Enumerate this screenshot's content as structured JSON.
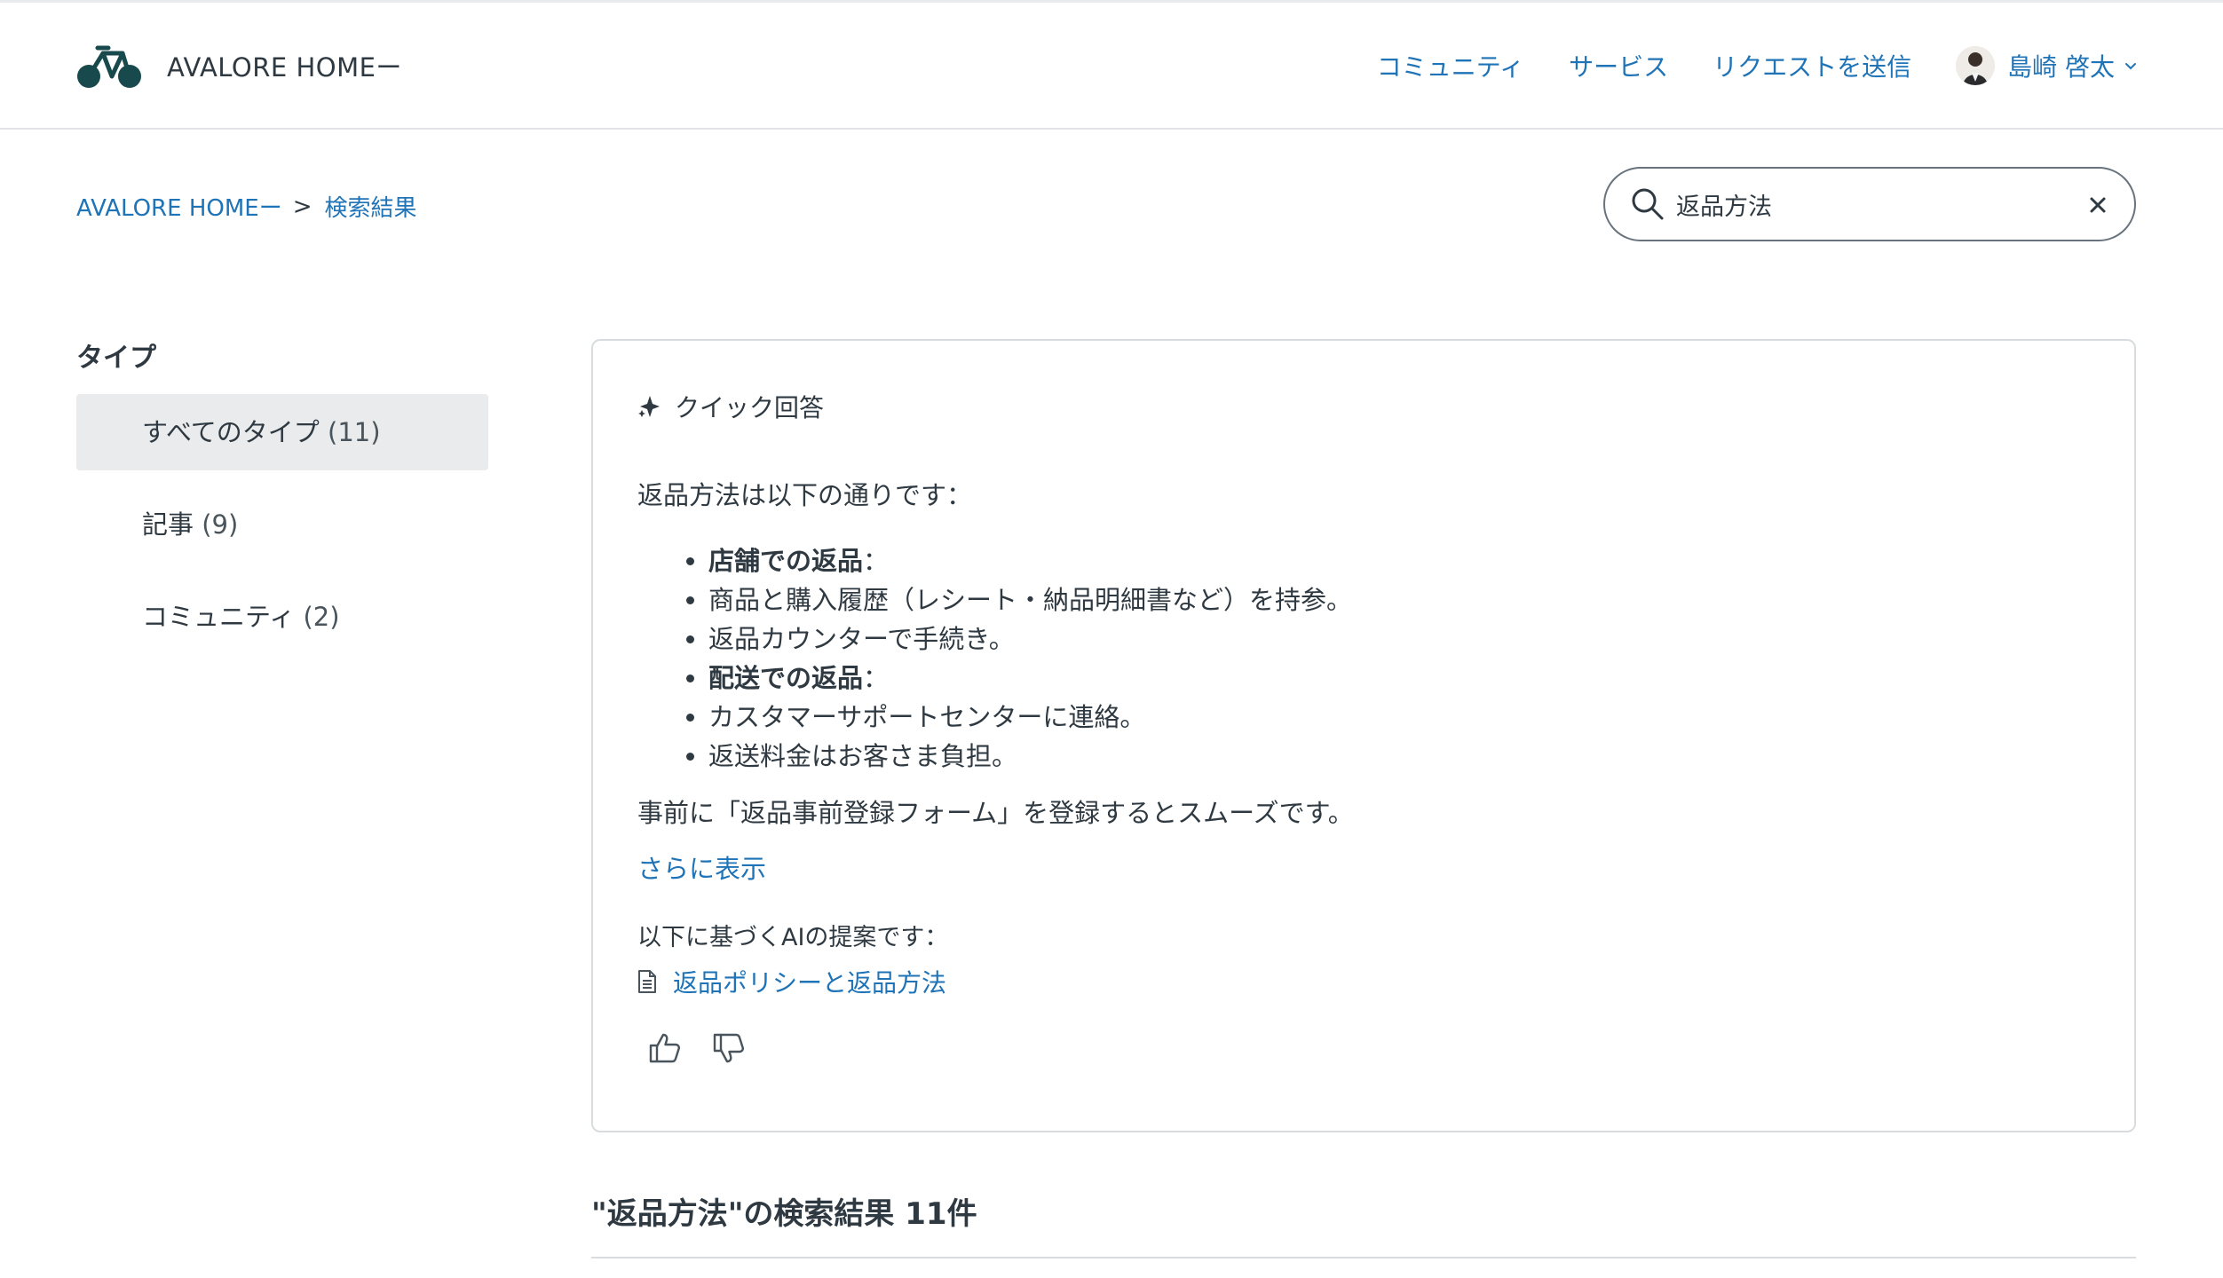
{
  "header": {
    "brand_name": "AVALORE HOMEー",
    "nav": {
      "community": "コミュニティ",
      "services": "サービス",
      "submit_request": "リクエストを送信"
    },
    "user_name": "島崎 啓太"
  },
  "breadcrumb": {
    "home": "AVALORE HOMEー",
    "separator": ">",
    "current": "検索結果"
  },
  "search": {
    "value": "返品方法"
  },
  "sidebar": {
    "title": "タイプ",
    "filters": [
      {
        "label": "すべてのタイプ",
        "count": "(11)",
        "active": true
      },
      {
        "label": "記事",
        "count": "(9)",
        "active": false
      },
      {
        "label": "コミュニティ",
        "count": "(2)",
        "active": false
      }
    ]
  },
  "quick_answer": {
    "title": "クイック回答",
    "intro": "返品方法は以下の通りです：",
    "items": [
      {
        "bold": "店舗での返品",
        "text": "："
      },
      {
        "bold": "",
        "text": "商品と購入履歴（レシート・納品明細書など）を持参。"
      },
      {
        "bold": "",
        "text": "返品カウンターで手続き。"
      },
      {
        "bold": "配送での返品",
        "text": "："
      },
      {
        "bold": "",
        "text": "カスタマーサポートセンターに連絡。"
      },
      {
        "bold": "",
        "text": "返送料金はお客さま負担。"
      }
    ],
    "note": "事前に「返品事前登録フォーム」を登録するとスムーズです。",
    "show_more": "さらに表示",
    "ai_note": "以下に基づくAIの提案です：",
    "source_link": "返品ポリシーと返品方法"
  },
  "results": {
    "title": "\"返品方法\"の検索結果 11件"
  },
  "colors": {
    "link": "#1f73b7",
    "text": "#2f3941",
    "active_filter_bg": "#e9ebed",
    "border": "#d8dcde",
    "logo": "#17494d"
  },
  "icons": {
    "logo": "bicycle-logo",
    "avatar": "user-avatar",
    "user_menu": "chevron-down-icon",
    "search": "search-icon",
    "clear": "close-icon",
    "quick_answer": "sparkle-icon",
    "source": "document-icon",
    "like": "thumbs-up-icon",
    "dislike": "thumbs-down-icon"
  }
}
